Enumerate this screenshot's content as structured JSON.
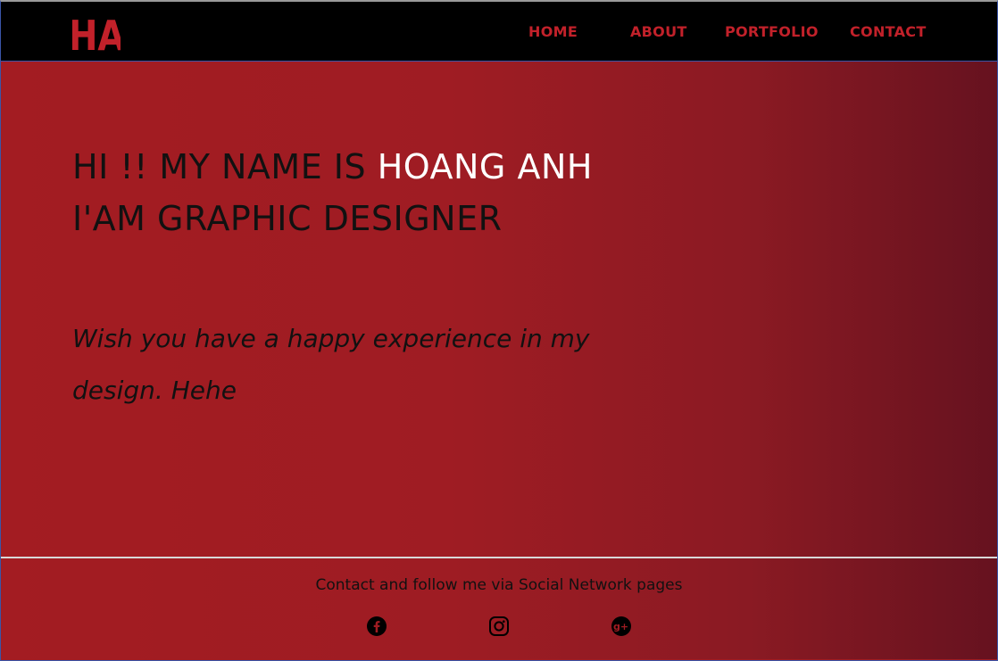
{
  "brand": {
    "logo_text": "HA",
    "accent": "#c2212a",
    "background": "#a01c22"
  },
  "nav": {
    "items": [
      {
        "label": "HOME"
      },
      {
        "label": "ABOUT"
      },
      {
        "label": "PORTFOLIO"
      },
      {
        "label": "CONTACT"
      }
    ]
  },
  "hero": {
    "greeting": "HI !! MY NAME IS ",
    "name": "HOANG ANH",
    "role": "I'AM GRAPHIC DESIGNER",
    "tagline_line1": "Wish you have a happy experience in my",
    "tagline_line2": "design. Hehe"
  },
  "footer": {
    "contact_text": "Contact and follow me via Social Network pages",
    "social": [
      {
        "icon": "facebook-icon"
      },
      {
        "icon": "instagram-icon"
      },
      {
        "icon": "google-plus-icon"
      }
    ]
  }
}
